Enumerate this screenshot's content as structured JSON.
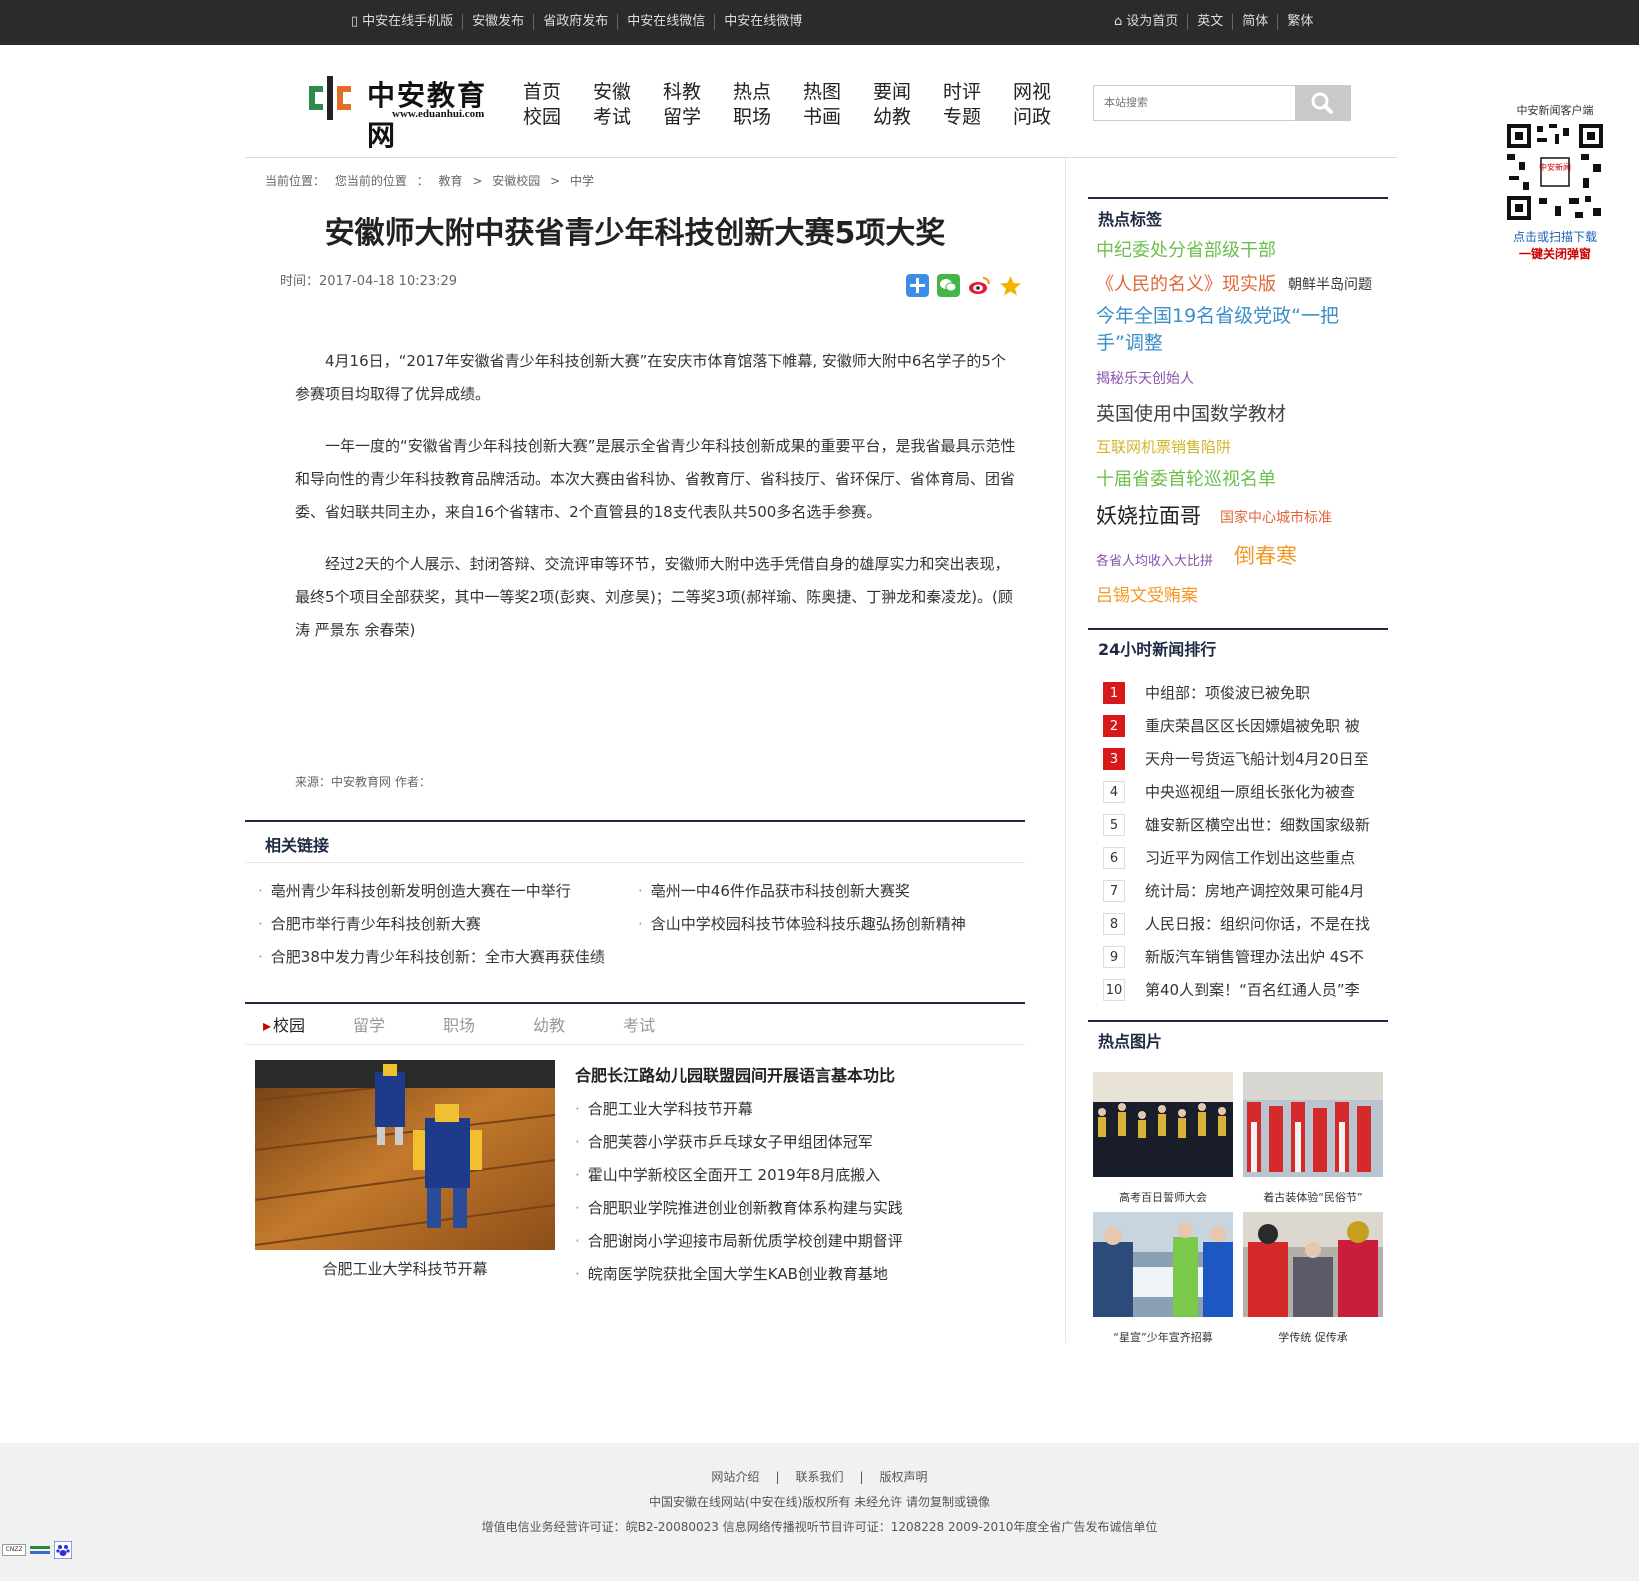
{
  "topbar": {
    "left": [
      "中安在线手机版",
      "安徽发布",
      "省政府发布",
      "中安在线微信",
      "中安在线微博"
    ],
    "right": [
      "设为首页",
      "英文",
      "简体",
      "繁体"
    ]
  },
  "logo": {
    "name": "中安教育网",
    "url": "www.eduanhui.com"
  },
  "nav": [
    [
      "首页",
      "校园"
    ],
    [
      "安徽",
      "考试"
    ],
    [
      "科教",
      "留学"
    ],
    [
      "热点",
      "职场"
    ],
    [
      "热图",
      "书画"
    ],
    [
      "要闻",
      "幼教"
    ],
    [
      "时评",
      "专题"
    ],
    [
      "网视",
      "问政"
    ]
  ],
  "search": {
    "placeholder": "本站搜索"
  },
  "qr": {
    "title": "中安新闻客户端",
    "tip1": "点击或扫描下载",
    "tip2": "一键关闭弹窗",
    "logo": "中安新闻"
  },
  "breadcrumb": {
    "label": "当前位置：",
    "items": [
      "您当前的位置",
      "：",
      "教育",
      ">",
      "安徽校园",
      ">",
      "中学"
    ]
  },
  "article": {
    "title": "安徽师大附中获省青少年科技创新大赛5项大奖",
    "time": "时间：2017-04-18 10:23:29",
    "paragraphs": [
      "4月16日，“2017年安徽省青少年科技创新大赛”在安庆市体育馆落下帷幕, 安徽师大附中6名学子的5个参赛项目均取得了优异成绩。",
      "一年一度的“安徽省青少年科技创新大赛”是展示全省青少年科技创新成果的重要平台，是我省最具示范性和导向性的青少年科技教育品牌活动。本次大赛由省科协、省教育厅、省科技厅、省环保厅、省体育局、团省委、省妇联共同主办，来自16个省辖市、2个直管县的18支代表队共500多名选手参赛。",
      "经过2天的个人展示、封闭答辩、交流评审等环节，安徽师大附中选手凭借自身的雄厚实力和突出表现，最终5个项目全部获奖，其中一等奖2项(彭爽、刘彦昊)；二等奖3项(郝祥瑜、陈奥捷、丁翀龙和秦凌龙)。(顾涛 严景东 余春荣)"
    ],
    "source": "来源：中安教育网   作者："
  },
  "related": {
    "title": "相关链接",
    "items": [
      "亳州青少年科技创新发明创造大赛在一中举行",
      "亳州一中46件作品获市科技创新大赛奖",
      "合肥市举行青少年科技创新大赛",
      "含山中学校园科技节体验科技乐趣弘扬创新精神",
      "合肥38中发力青少年科技创新：全市大赛再获佳绩"
    ]
  },
  "tabs": [
    "校园",
    "留学",
    "职场",
    "幼教",
    "考试"
  ],
  "campus": {
    "caption": "合肥工业大学科技节开幕",
    "headline": "合肥长江路幼儿园联盟园间开展语言基本功比",
    "items": [
      "合肥工业大学科技节开幕",
      "合肥芙蓉小学获市乒乓球女子甲组团体冠军",
      "霍山中学新校区全面开工 2019年8月底搬入",
      "合肥职业学院推进创业创新教育体系构建与实践",
      "合肥谢岗小学迎接市局新优质学校创建中期督评",
      "皖南医学院获批全国大学生KAB创业教育基地"
    ]
  },
  "hot_tags": {
    "title": "热点标签",
    "items": [
      {
        "text": "中纪委处分省部级干部",
        "color": "#6cbf4e"
      },
      {
        "text": "《人民的名义》现实版",
        "color": "#e0673a"
      },
      {
        "text": "朝鲜半岛问题",
        "color": "#333333"
      },
      {
        "text": "今年全国19名省级党政“一把手”调整",
        "color": "#3b8fc6"
      },
      {
        "text": "揭秘乐天创始人",
        "color": "#8855aa"
      },
      {
        "text": "英国使用中国数学教材",
        "color": "#444444"
      },
      {
        "text": "互联网机票销售陷阱",
        "color": "#d4b528"
      },
      {
        "text": "十届省委首轮巡视名单",
        "color": "#6cbf4e"
      },
      {
        "text": "妖娆拉面哥",
        "color": "#222222"
      },
      {
        "text": "国家中心城市标准",
        "color": "#e0673a"
      },
      {
        "text": "各省人均收入大比拼",
        "color": "#8855aa"
      },
      {
        "text": "倒春寒",
        "color": "#f39826"
      },
      {
        "text": "吕锡文受贿案",
        "color": "#f39826"
      }
    ]
  },
  "ranking": {
    "title": "24小时新闻排行",
    "items": [
      {
        "num": "1",
        "text": "中组部：项俊波已被免职"
      },
      {
        "num": "2",
        "text": "重庆荣昌区区长因嫖娼被免职 被"
      },
      {
        "num": "3",
        "text": "天舟一号货运飞船计划4月20日至"
      },
      {
        "num": "4",
        "text": "中央巡视组一原组长张化为被查"
      },
      {
        "num": "5",
        "text": "雄安新区横空出世：细数国家级新"
      },
      {
        "num": "6",
        "text": "习近平为网信工作划出这些重点"
      },
      {
        "num": "7",
        "text": "统计局：房地产调控效果可能4月"
      },
      {
        "num": "8",
        "text": "人民日报：组织问你话，不是在找"
      },
      {
        "num": "9",
        "text": "新版汽车销售管理办法出炉 4S不"
      },
      {
        "num": "10",
        "text": "第40人到案！“百名红通人员”李"
      }
    ]
  },
  "hot_pics": {
    "title": "热点图片",
    "items": [
      "高考百日誓师大会",
      "着古装体验“民俗节”",
      "“星宣”少年宣齐招募",
      "学传统 促传承"
    ]
  },
  "footer": {
    "links": [
      "网站介绍",
      "|",
      "联系我们",
      "|",
      "版权声明"
    ],
    "copyright": "中国安徽在线网站(中安在线)版权所有 未经允许 请勿复制或镜像",
    "license": "增值电信业务经营许可证：皖B2-20080023 信息网络传播视听节目许可证：1208228   2009-2010年度全省广告发布诚信单位"
  },
  "badges": {
    "cnzz": "CNZZ"
  }
}
